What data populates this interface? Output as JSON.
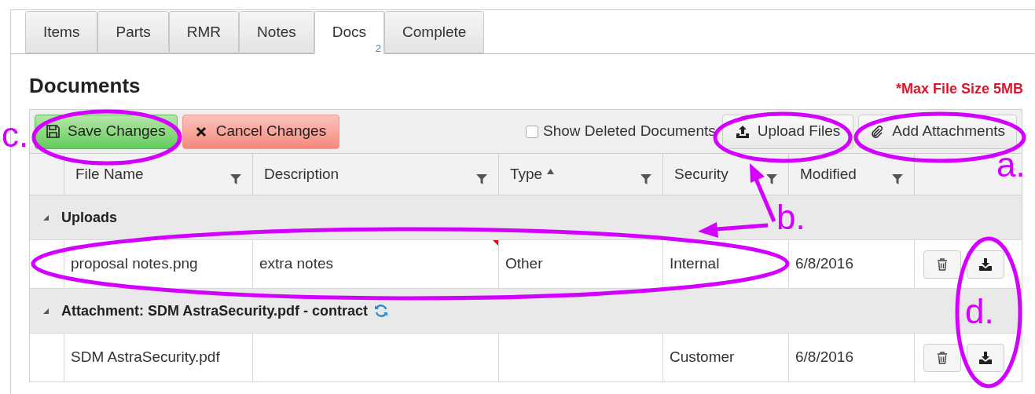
{
  "tabs": [
    {
      "label": "Items",
      "selected": false
    },
    {
      "label": "Parts",
      "selected": false
    },
    {
      "label": "RMR",
      "selected": false
    },
    {
      "label": "Notes",
      "selected": false
    },
    {
      "label": "Docs",
      "selected": true,
      "badge": "2"
    },
    {
      "label": "Complete",
      "selected": false
    }
  ],
  "heading": "Documents",
  "max_size_note": "*Max File Size 5MB",
  "toolbar": {
    "save": "Save Changes",
    "cancel": "Cancel Changes",
    "show_deleted": {
      "label": "Show Deleted Documents",
      "checked": false
    },
    "upload": "Upload Files",
    "attach": "Add Attachments"
  },
  "table": {
    "columns": [
      {
        "label": "File Name",
        "sorted": false
      },
      {
        "label": "Description",
        "sorted": false
      },
      {
        "label": "Type",
        "sorted": true
      },
      {
        "label": "Security",
        "sorted": false
      },
      {
        "label": "Modified",
        "sorted": false
      }
    ],
    "groups": [
      {
        "title": "Uploads",
        "expanded": true,
        "refresh": false,
        "rows": [
          {
            "file_name": "proposal notes.png",
            "description": "extra notes",
            "edited": true,
            "type": "Other",
            "security": "Internal",
            "modified": "6/8/2016"
          }
        ]
      },
      {
        "title": "Attachment: SDM AstraSecurity.pdf - contract",
        "expanded": true,
        "refresh": true,
        "rows": [
          {
            "file_name": "SDM AstraSecurity.pdf",
            "description": "",
            "edited": false,
            "type": "",
            "security": "Customer",
            "modified": "6/8/2016"
          }
        ]
      }
    ]
  },
  "annotations": [
    {
      "label": "c."
    },
    {
      "label": "a."
    },
    {
      "label": "b."
    },
    {
      "label": "d."
    }
  ]
}
